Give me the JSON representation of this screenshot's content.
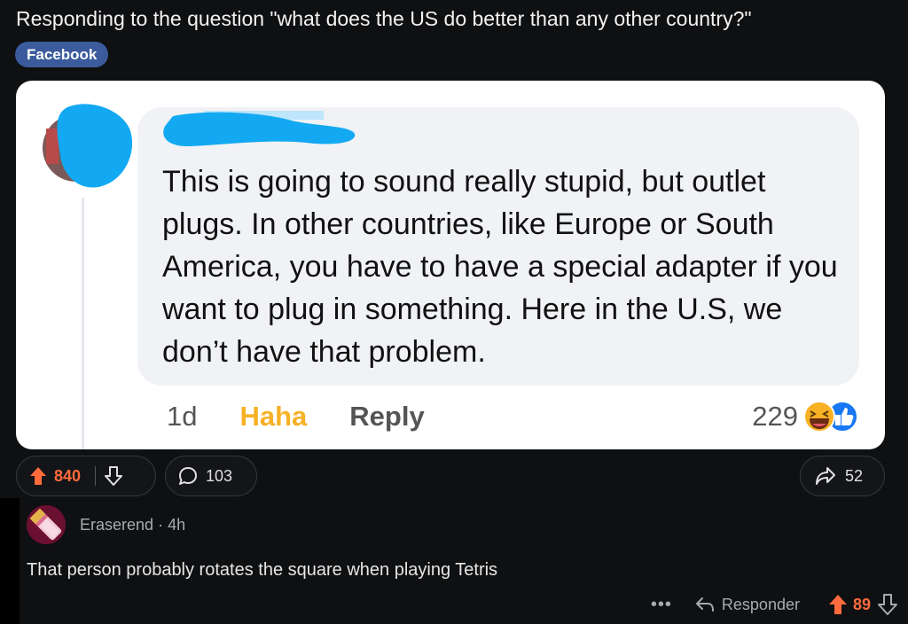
{
  "post": {
    "title": "Responding to the question \"what does the US do better than any other country?\"",
    "flair": "Facebook"
  },
  "fb_comment": {
    "text": "This is going to sound really stupid, but outlet plugs. In other countries, like Europe or South America, you have to have a special adapter if you want to plug in something. Here in the U.S, we don’t have that problem.",
    "time": "1d",
    "haha_label": "Haha",
    "reply_label": "Reply",
    "reaction_count": "229",
    "reaction_icons": [
      "haha-emoji-icon",
      "like-thumb-icon"
    ]
  },
  "post_actions": {
    "vote_count": "840",
    "comment_count": "103",
    "share_count": "52",
    "icons": [
      "upvote-arrow-icon",
      "downvote-arrow-icon",
      "comment-bubble-icon",
      "share-arrow-icon"
    ]
  },
  "reply": {
    "username": "Eraserend",
    "separator": "·",
    "age": "4h",
    "text": "That person probably rotates the square when playing Tetris",
    "more_label": "•••",
    "responder_label": "Responder",
    "vote_count": "89"
  },
  "colors": {
    "upvote": "#ff6b3d",
    "flair_bg": "#3b5b9c",
    "haha": "#f7b125",
    "redaction": "#13a9f2",
    "like_blue": "#1877f2"
  }
}
